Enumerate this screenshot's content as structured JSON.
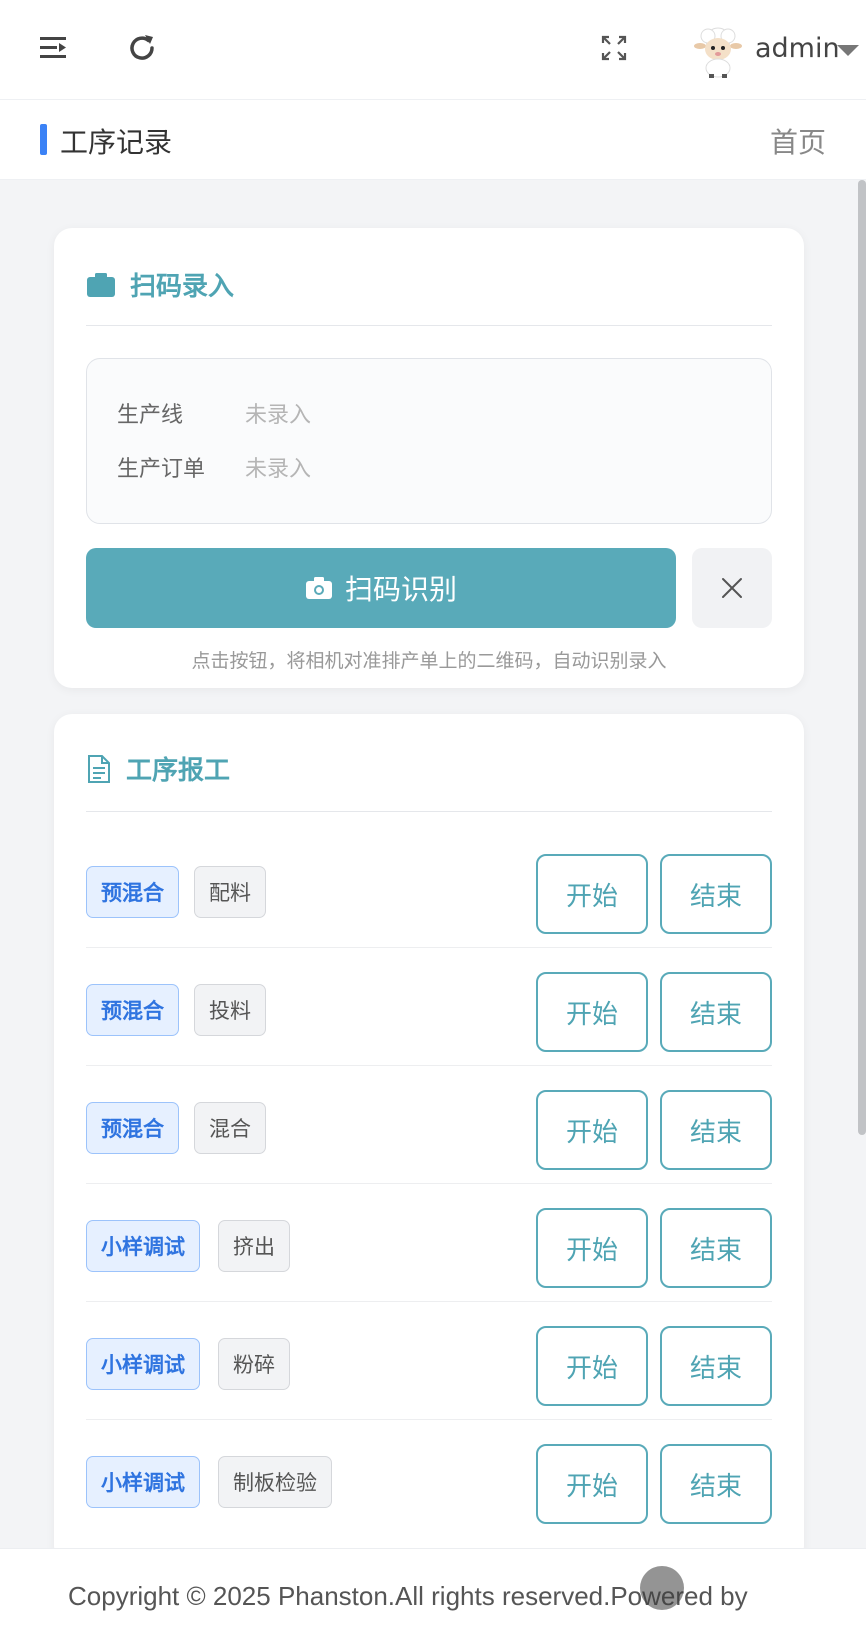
{
  "header": {
    "username": "admin"
  },
  "page": {
    "title": "工序记录",
    "home_link": "首页"
  },
  "scan_card": {
    "title": "扫码录入",
    "fields": [
      {
        "label": "生产线",
        "value": "未录入"
      },
      {
        "label": "生产订单",
        "value": "未录入"
      }
    ],
    "scan_button_label": "扫码识别",
    "hint": "点击按钮，将相机对准排产单上的二维码，自动识别录入"
  },
  "process_card": {
    "title": "工序报工",
    "start_label": "开始",
    "end_label": "结束",
    "rows": [
      {
        "stage": "预混合",
        "step": "配料"
      },
      {
        "stage": "预混合",
        "step": "投料"
      },
      {
        "stage": "预混合",
        "step": "混合"
      },
      {
        "stage": "小样调试",
        "step": "挤出"
      },
      {
        "stage": "小样调试",
        "step": "粉碎"
      },
      {
        "stage": "小样调试",
        "step": "制板检验"
      }
    ]
  },
  "footer": {
    "copyright": "Copyright © 2025 Phanston.All rights reserved.Powered by"
  },
  "colors": {
    "accent": "#59aab9",
    "stage_tag": "#2f74e0",
    "title_bar_accent": "#3b82f6"
  }
}
